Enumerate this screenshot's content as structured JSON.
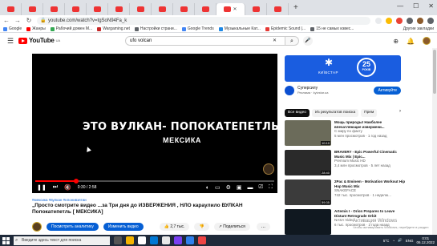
{
  "browser": {
    "window_controls": [
      "—",
      "☐",
      "✕"
    ],
    "url": "youtube.com/watch?v=tgSoN94Fa_k",
    "bookmarks": [
      {
        "label": "Google",
        "color": "#4285f4"
      },
      {
        "label": "Жанры",
        "color": "#ff0000"
      },
      {
        "label": "Рабочий домен М...",
        "color": "#34a853"
      },
      {
        "label": "Wargaming.net",
        "color": "#c62828"
      },
      {
        "label": "Настройки страни...",
        "color": "#5f6368"
      },
      {
        "label": "Google Trends",
        "color": "#4285f4"
      },
      {
        "label": "Музыкальные Кат...",
        "color": "#1e88e5"
      },
      {
        "label": "Epidemic Sound |...",
        "color": "#e53935"
      },
      {
        "label": "15 не самых извес...",
        "color": "#5f6368"
      }
    ],
    "bookmarks_other": "Другие закладки"
  },
  "youtube": {
    "logo_text": "YouTube",
    "region": "UA",
    "search_query": "ufo volcan",
    "search_clear": "✕",
    "search_icon": "⌕",
    "mic_icon": "🎤",
    "header_icons": [
      "⊕",
      "🔔"
    ]
  },
  "player": {
    "overlay_title": "ЭТО ВУЛКАН- ПОПОКАТЕПЕТЛЬ",
    "overlay_sub": "МЕКСИКА",
    "time": "0:30 / 2:58",
    "progress": 0.17
  },
  "video": {
    "hashtags": "#мексика #вулкан #нлонивзятии",
    "title": "„Просто смотрите видео ...за Три дня до ИЗВЕРЖЕНИЯ , НЛО караулило ВУЛКАН Попокатепетль [ МЕКСИКА]",
    "analytics_btn": "Посмотреть аналитику",
    "edit_btn": "Изменить видео",
    "likes": "2,7 тыс.",
    "share": "Поделиться",
    "more": "..."
  },
  "ad": {
    "brand": "КИЇВСТАР",
    "badge_num": "25",
    "badge_text": "РОКІВ",
    "title": "Суперсилу",
    "label": "Реклама · kyivstar.ua",
    "button": "Активуйте"
  },
  "chips": [
    "Все видео",
    "Из результатов поиска",
    "Прем"
  ],
  "recommendations": [
    {
      "title": "Мощь природы! Наиболее впечатляющие извержени...",
      "channel": "С миру по факту",
      "meta": "5 млн просмотров · 1 год назад",
      "duration": "10:10",
      "color": "#6b6b5a"
    },
    {
      "title": "BRAVERY - Epic Powerful Cinematic Music Mix | Epic...",
      "channel": "Premium Music HD",
      "meta": "3,4 млн просмотров · 5 лет назад",
      "duration": "28:40",
      "color": "#2a2a2a"
    },
    {
      "title": "2Pac & Eminem - Motivation Workout Hip Hop Music Mix",
      "channel": "SNAKEFACE",
      "meta": "742 тыс. просмотров · 1 неделю...",
      "duration": "59:35",
      "color": "#3b3b3b"
    },
    {
      "title": "Artemis I - Orion Prepares to Leave Distant Retrograde Orbit",
      "channel": "NASA Video",
      "meta": "6 тыс. просмотров · 2 года назад",
      "duration": "",
      "color": "#101820"
    }
  ],
  "windows": {
    "activate": [
      "Активация Windows",
      "Чтобы активировать Windows, перейдите в раздел"
    ],
    "search_placeholder": "Введите здесь текст для поиска",
    "temp": "5°C",
    "lang": "ENG",
    "time": "0:01",
    "date": "06.12.2022"
  }
}
